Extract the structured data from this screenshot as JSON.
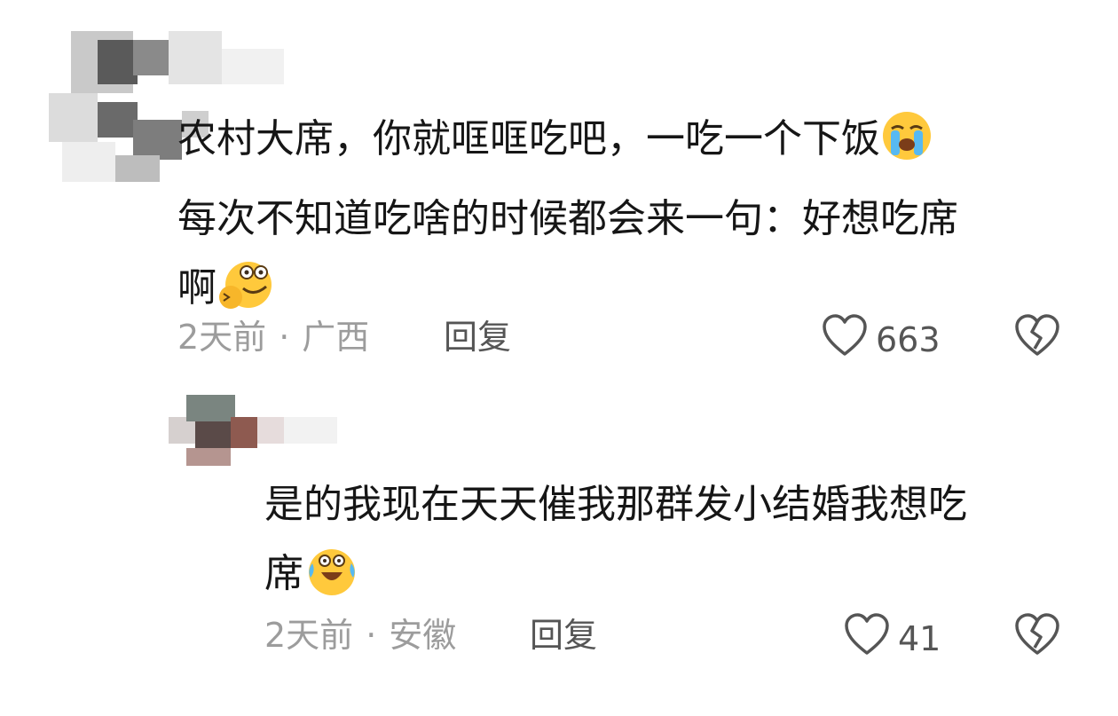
{
  "comments": [
    {
      "lines": [
        "农村大席，你就哐哐吃吧，一吃一个下饭",
        "每次不知道吃啥的时候都会来一句：好想吃席",
        "啊"
      ],
      "emojis": [
        "loudly-crying-emoji",
        "drooling-smile-emoji"
      ],
      "time": "2天前",
      "separator": "·",
      "location": "广西",
      "reply_label": "回复",
      "like_count": "663"
    },
    {
      "lines": [
        "是的我现在天天催我那群发小结婚我想吃",
        "席"
      ],
      "emojis": [
        "tears-of-joy-emoji"
      ],
      "time": "2天前",
      "separator": "·",
      "location": "安徽",
      "reply_label": "回复",
      "like_count": "41"
    }
  ],
  "icons": {
    "like": "heart-outline-icon",
    "dislike": "broken-heart-icon"
  },
  "colors": {
    "text": "#161616",
    "meta": "#9c9c9c",
    "action": "#555555",
    "emoji": "#ffc93c"
  }
}
